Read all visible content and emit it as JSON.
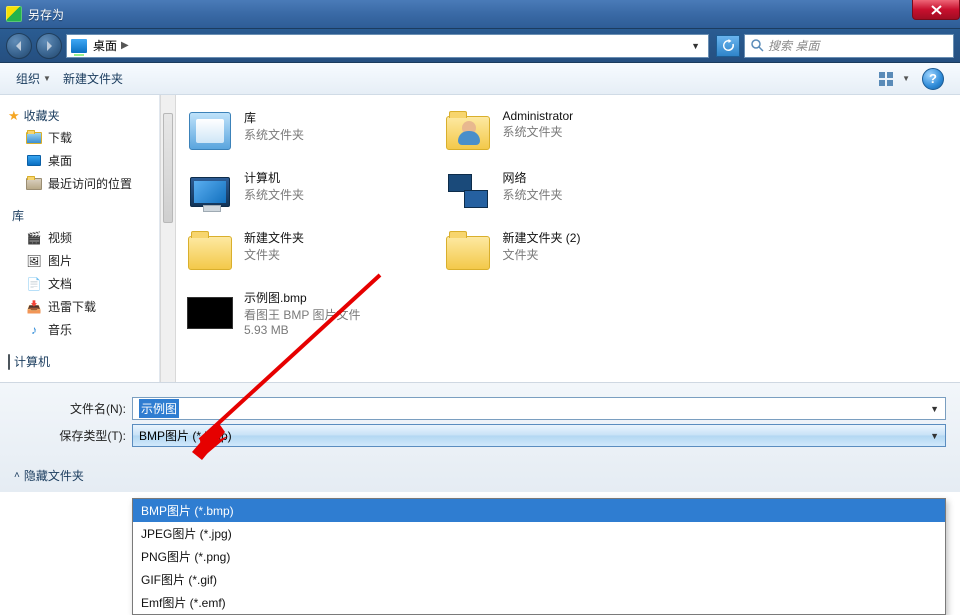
{
  "window": {
    "title": "另存为"
  },
  "nav": {
    "location_root": "桌面",
    "search_placeholder": "搜索 桌面"
  },
  "toolbar": {
    "organize": "组织",
    "new_folder": "新建文件夹"
  },
  "sidebar": {
    "favorites": {
      "label": "收藏夹",
      "items": [
        {
          "label": "下载"
        },
        {
          "label": "桌面"
        },
        {
          "label": "最近访问的位置"
        }
      ]
    },
    "libraries": {
      "label": "库",
      "items": [
        {
          "label": "视频"
        },
        {
          "label": "图片"
        },
        {
          "label": "文档"
        },
        {
          "label": "迅雷下载"
        },
        {
          "label": "音乐"
        }
      ]
    },
    "computer": {
      "label": "计算机"
    }
  },
  "items": [
    {
      "name": "库",
      "sub1": "系统文件夹",
      "kind": "lib"
    },
    {
      "name": "Administrator",
      "sub1": "系统文件夹",
      "kind": "user"
    },
    {
      "name": "计算机",
      "sub1": "系统文件夹",
      "kind": "pc"
    },
    {
      "name": "网络",
      "sub1": "系统文件夹",
      "kind": "net"
    },
    {
      "name": "新建文件夹",
      "sub1": "文件夹",
      "kind": "folder"
    },
    {
      "name": "新建文件夹 (2)",
      "sub1": "文件夹",
      "kind": "folder"
    },
    {
      "name": "示例图.bmp",
      "sub1": "看图王 BMP 图片文件",
      "sub2": "5.93 MB",
      "kind": "bmp"
    }
  ],
  "form": {
    "filename_label": "文件名(N):",
    "filename_value": "示例图",
    "filetype_label": "保存类型(T):",
    "filetype_value": "BMP图片 (*.bmp)",
    "options": [
      "BMP图片 (*.bmp)",
      "JPEG图片 (*.jpg)",
      "PNG图片 (*.png)",
      "GIF图片 (*.gif)",
      "Emf图片 (*.emf)"
    ],
    "hide_folders": "隐藏文件夹"
  }
}
